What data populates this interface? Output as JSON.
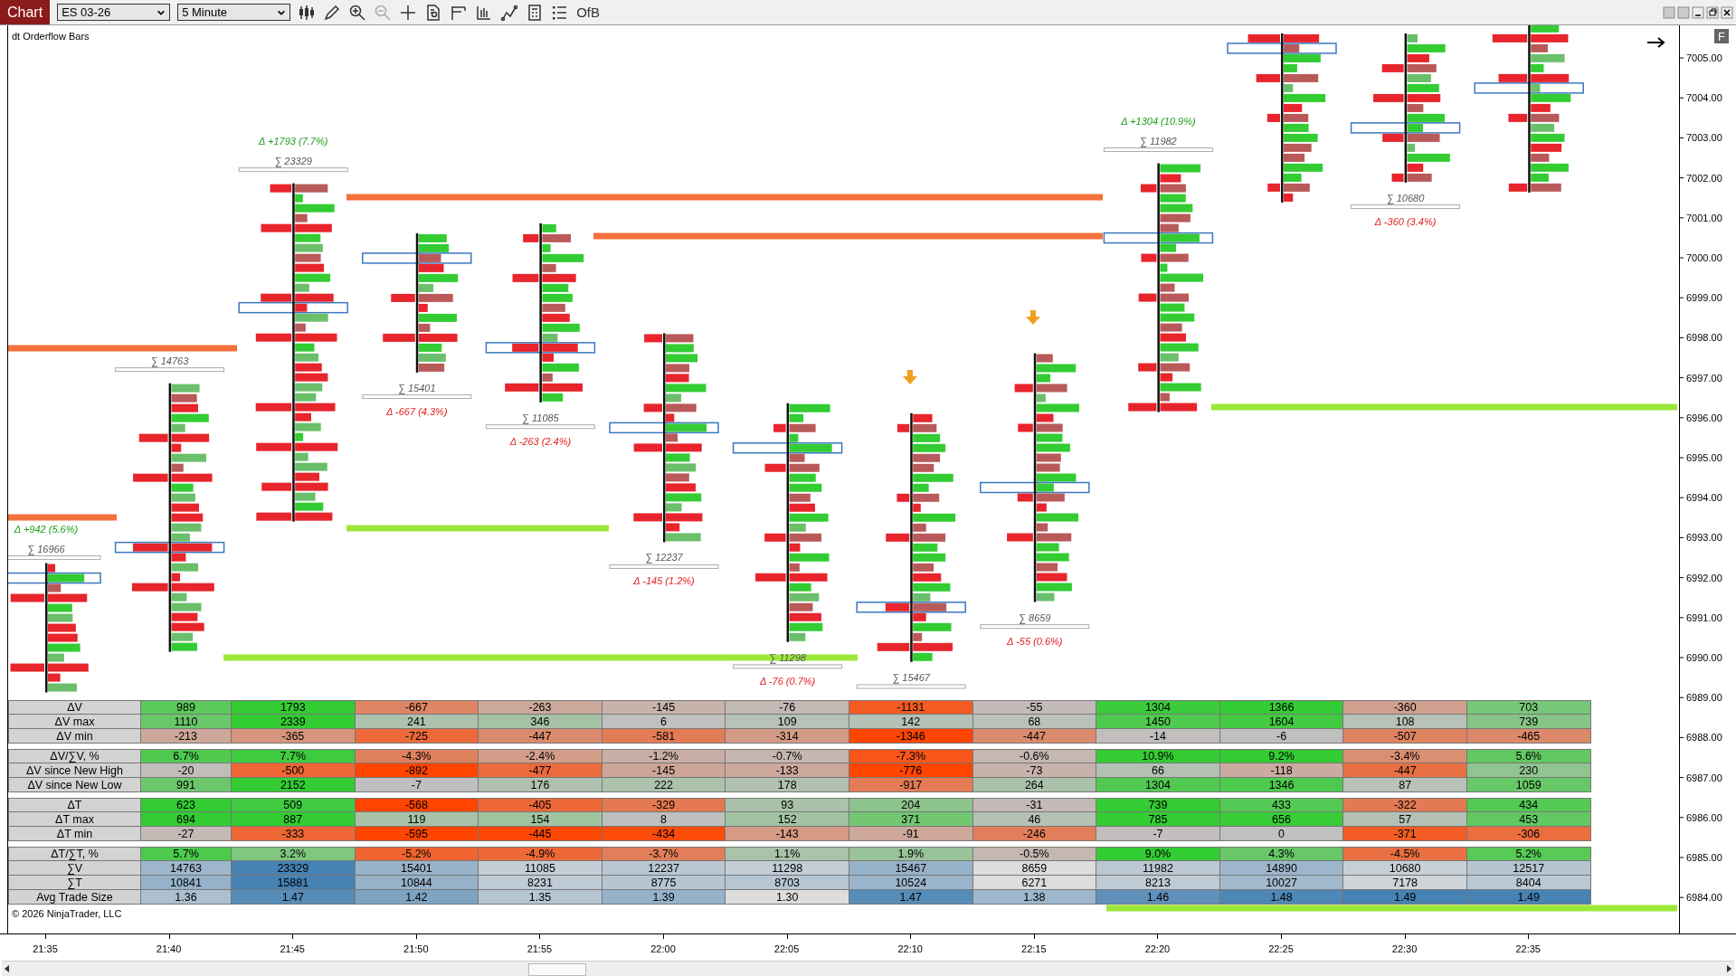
{
  "toolbar": {
    "tab": "Chart",
    "instrument": "ES 03-26",
    "interval": "5 Minute",
    "indicator_label": "OfB"
  },
  "chart": {
    "title": "dt Orderflow Bars",
    "axis_button": "F",
    "price_labels": [
      "7005.00",
      "7004.00",
      "7003.00",
      "7002.00",
      "7001.00",
      "7000.00",
      "6999.00",
      "6998.00",
      "6997.00",
      "6996.00",
      "6995.00",
      "6994.00",
      "6993.00",
      "6992.00",
      "6991.00",
      "6990.00",
      "6989.00",
      "6988.00",
      "6987.00",
      "6986.00",
      "6985.00",
      "6984.00"
    ],
    "time_labels": [
      "21:35",
      "21:40",
      "21:45",
      "21:50",
      "21:55",
      "22:00",
      "22:05",
      "22:10",
      "22:15",
      "22:20",
      "22:25",
      "22:30",
      "22:35"
    ],
    "summaries": [
      {
        "positive": true,
        "delta": "Δ +942 (5.6%)",
        "sum": "∑ 16966"
      },
      {
        "sum": "∑ 14763"
      },
      {
        "positive": true,
        "delta": "Δ +1793 (7.7%)",
        "sum": "∑ 23329"
      },
      {
        "positive": false,
        "delta": "Δ -667 (4.3%)",
        "sum": "∑ 15401"
      },
      {
        "positive": false,
        "delta": "Δ -263 (2.4%)",
        "sum": "∑ 11085"
      },
      {
        "positive": false,
        "delta": "Δ -145 (1.2%)",
        "sum": "∑ 12237"
      },
      {
        "positive": false,
        "delta": "Δ -76 (0.7%)",
        "sum": "∑ 11298"
      },
      {
        "sum": "∑ 15467"
      },
      {
        "positive": false,
        "delta": "Δ -55 (0.6%)",
        "sum": "∑ 8659"
      },
      {
        "positive": true,
        "delta": "Δ +1304 (10.9%)",
        "sum": "∑ 11982"
      },
      {
        "positive": false,
        "delta": "Δ -360 (3.4%)",
        "sum": "∑ 10680"
      }
    ],
    "copyright": "© 2026 NinjaTrader, LLC"
  },
  "table": {
    "groups": [
      {
        "rows": [
          {
            "label": "ΔV",
            "kind": "delta",
            "values": [
              "989",
              "1793",
              "-667",
              "-263",
              "-145",
              "-76",
              "-1131",
              "-55",
              "1304",
              "1366",
              "-360",
              "703"
            ]
          },
          {
            "label": "ΔV max",
            "kind": "delta",
            "values": [
              "1110",
              "2339",
              "241",
              "346",
              "6",
              "109",
              "142",
              "68",
              "1450",
              "1604",
              "108",
              "739"
            ]
          },
          {
            "label": "ΔV min",
            "kind": "delta",
            "values": [
              "-213",
              "-365",
              "-725",
              "-447",
              "-581",
              "-314",
              "-1346",
              "-447",
              "-14",
              "-6",
              "-507",
              "-465"
            ]
          }
        ]
      },
      {
        "rows": [
          {
            "label": "ΔV/∑V, %",
            "kind": "delta",
            "values": [
              "6.7%",
              "7.7%",
              "-4.3%",
              "-2.4%",
              "-1.2%",
              "-0.7%",
              "-7.3%",
              "-0.6%",
              "10.9%",
              "9.2%",
              "-3.4%",
              "5.6%"
            ]
          },
          {
            "label": "ΔV since New High",
            "kind": "delta",
            "values": [
              "-20",
              "-500",
              "-892",
              "-477",
              "-145",
              "-133",
              "-776",
              "-73",
              "66",
              "-118",
              "-447",
              "230"
            ]
          },
          {
            "label": "ΔV since New Low",
            "kind": "delta",
            "values": [
              "991",
              "2152",
              "-7",
              "176",
              "222",
              "178",
              "-917",
              "264",
              "1304",
              "1346",
              "87",
              "1059"
            ]
          }
        ]
      },
      {
        "rows": [
          {
            "label": "ΔT",
            "kind": "delta",
            "values": [
              "623",
              "509",
              "-568",
              "-405",
              "-329",
              "93",
              "204",
              "-31",
              "739",
              "433",
              "-322",
              "434"
            ]
          },
          {
            "label": "ΔT max",
            "kind": "delta",
            "values": [
              "694",
              "887",
              "119",
              "154",
              "8",
              "152",
              "371",
              "46",
              "785",
              "656",
              "57",
              "453"
            ]
          },
          {
            "label": "ΔT min",
            "kind": "delta",
            "values": [
              "-27",
              "-333",
              "-595",
              "-445",
              "-434",
              "-143",
              "-91",
              "-246",
              "-7",
              "0",
              "-371",
              "-306"
            ]
          }
        ]
      },
      {
        "rows": [
          {
            "label": "ΔT/∑T, %",
            "kind": "delta",
            "values": [
              "5.7%",
              "3.2%",
              "-5.2%",
              "-4.9%",
              "-3.7%",
              "1.1%",
              "1.9%",
              "-0.5%",
              "9.0%",
              "4.3%",
              "-4.5%",
              "5.2%"
            ]
          },
          {
            "label": "∑V",
            "kind": "total",
            "values": [
              "14763",
              "23329",
              "15401",
              "11085",
              "12237",
              "11298",
              "15467",
              "8659",
              "11982",
              "14890",
              "10680",
              "12517"
            ]
          },
          {
            "label": "∑T",
            "kind": "total",
            "values": [
              "10841",
              "15881",
              "10844",
              "8231",
              "8775",
              "8703",
              "10524",
              "6271",
              "8213",
              "10027",
              "7178",
              "8404"
            ]
          },
          {
            "label": "Avg Trade Size",
            "kind": "total",
            "values": [
              "1.36",
              "1.47",
              "1.42",
              "1.35",
              "1.39",
              "1.30",
              "1.47",
              "1.38",
              "1.46",
              "1.48",
              "1.49",
              "1.49"
            ]
          }
        ]
      }
    ]
  }
}
